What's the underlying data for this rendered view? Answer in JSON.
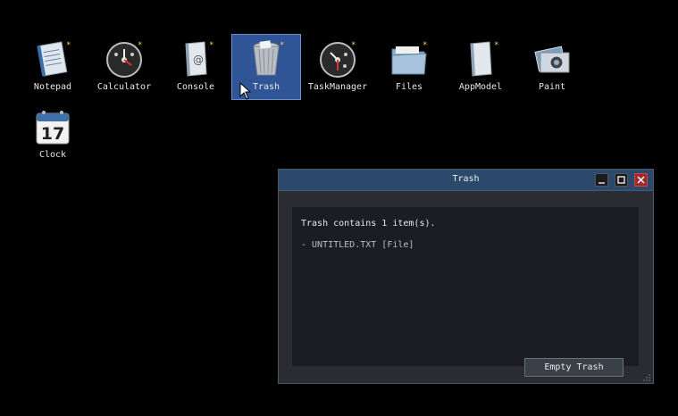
{
  "desktop": {
    "icons": [
      {
        "label": "Notepad",
        "icon": "notepad-icon"
      },
      {
        "label": "Calculator",
        "icon": "calculator-icon"
      },
      {
        "label": "Console",
        "icon": "console-icon"
      },
      {
        "label": "Trash",
        "icon": "trash-icon",
        "selected": true
      },
      {
        "label": "TaskManager",
        "icon": "taskmanager-icon"
      },
      {
        "label": "Files",
        "icon": "folder-icon"
      },
      {
        "label": "AppModel",
        "icon": "appmodel-icon"
      },
      {
        "label": "Paint",
        "icon": "paint-icon"
      },
      {
        "label": "Clock",
        "icon": "calendar-icon",
        "calendar_day": "17"
      }
    ]
  },
  "trash_window": {
    "title": "Trash",
    "summary": "Trash contains 1 item(s).",
    "items": [
      "- UNTITLED.TXT [File]"
    ],
    "empty_button": "Empty Trash"
  },
  "colors": {
    "desktop_bg": "#000000",
    "selection": "#2f5597",
    "titlebar": "#2b4a6b",
    "close_button": "#9c2a2a"
  }
}
